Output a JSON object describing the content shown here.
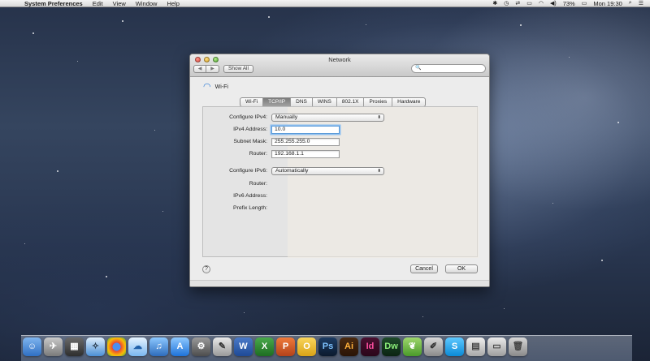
{
  "menubar": {
    "apple": "",
    "app": "System Preferences",
    "items": [
      "Edit",
      "View",
      "Window",
      "Help"
    ],
    "battery": "73%",
    "clock": "Mon 19:30"
  },
  "window": {
    "title": "Network",
    "back": "◀",
    "forward": "▶",
    "show_all": "Show All",
    "search_placeholder": "🔍",
    "interface_name": "Wi-Fi",
    "tabs": [
      "Wi-Fi",
      "TCP/IP",
      "DNS",
      "WINS",
      "802.1X",
      "Proxies",
      "Hardware"
    ],
    "active_tab": "TCP/IP",
    "configure_ipv4_label": "Configure IPv4:",
    "configure_ipv4_value": "Manually",
    "ipv4_address_label": "IPv4 Address:",
    "ipv4_address_value": "10.0",
    "subnet_mask_label": "Subnet Mask:",
    "subnet_mask_value": "255.255.255.0",
    "router_label": "Router:",
    "router_value": "192.168.1.1",
    "configure_ipv6_label": "Configure IPv6:",
    "configure_ipv6_value": "Automatically",
    "ipv6_router_label": "Router:",
    "ipv6_address_label": "IPv6 Address:",
    "prefix_length_label": "Prefix Length:",
    "help": "?",
    "cancel": "Cancel",
    "ok": "OK"
  },
  "dock": {
    "icons": [
      "finder-icon",
      "launchpad-icon",
      "mission-control-icon",
      "safari-icon",
      "chrome-icon",
      "messages-icon",
      "itunes-icon",
      "app-store-icon",
      "system-preferences-icon",
      "preview-icon",
      "word-icon",
      "excel-icon",
      "powerpoint-icon",
      "outlook-icon",
      "photoshop-icon",
      "illustrator-icon",
      "indesign-icon",
      "dreamweaver-icon",
      "leaf-icon",
      "pencil-icon",
      "skype-icon",
      "folder-icon",
      "screen-icon",
      "trash-icon"
    ]
  }
}
